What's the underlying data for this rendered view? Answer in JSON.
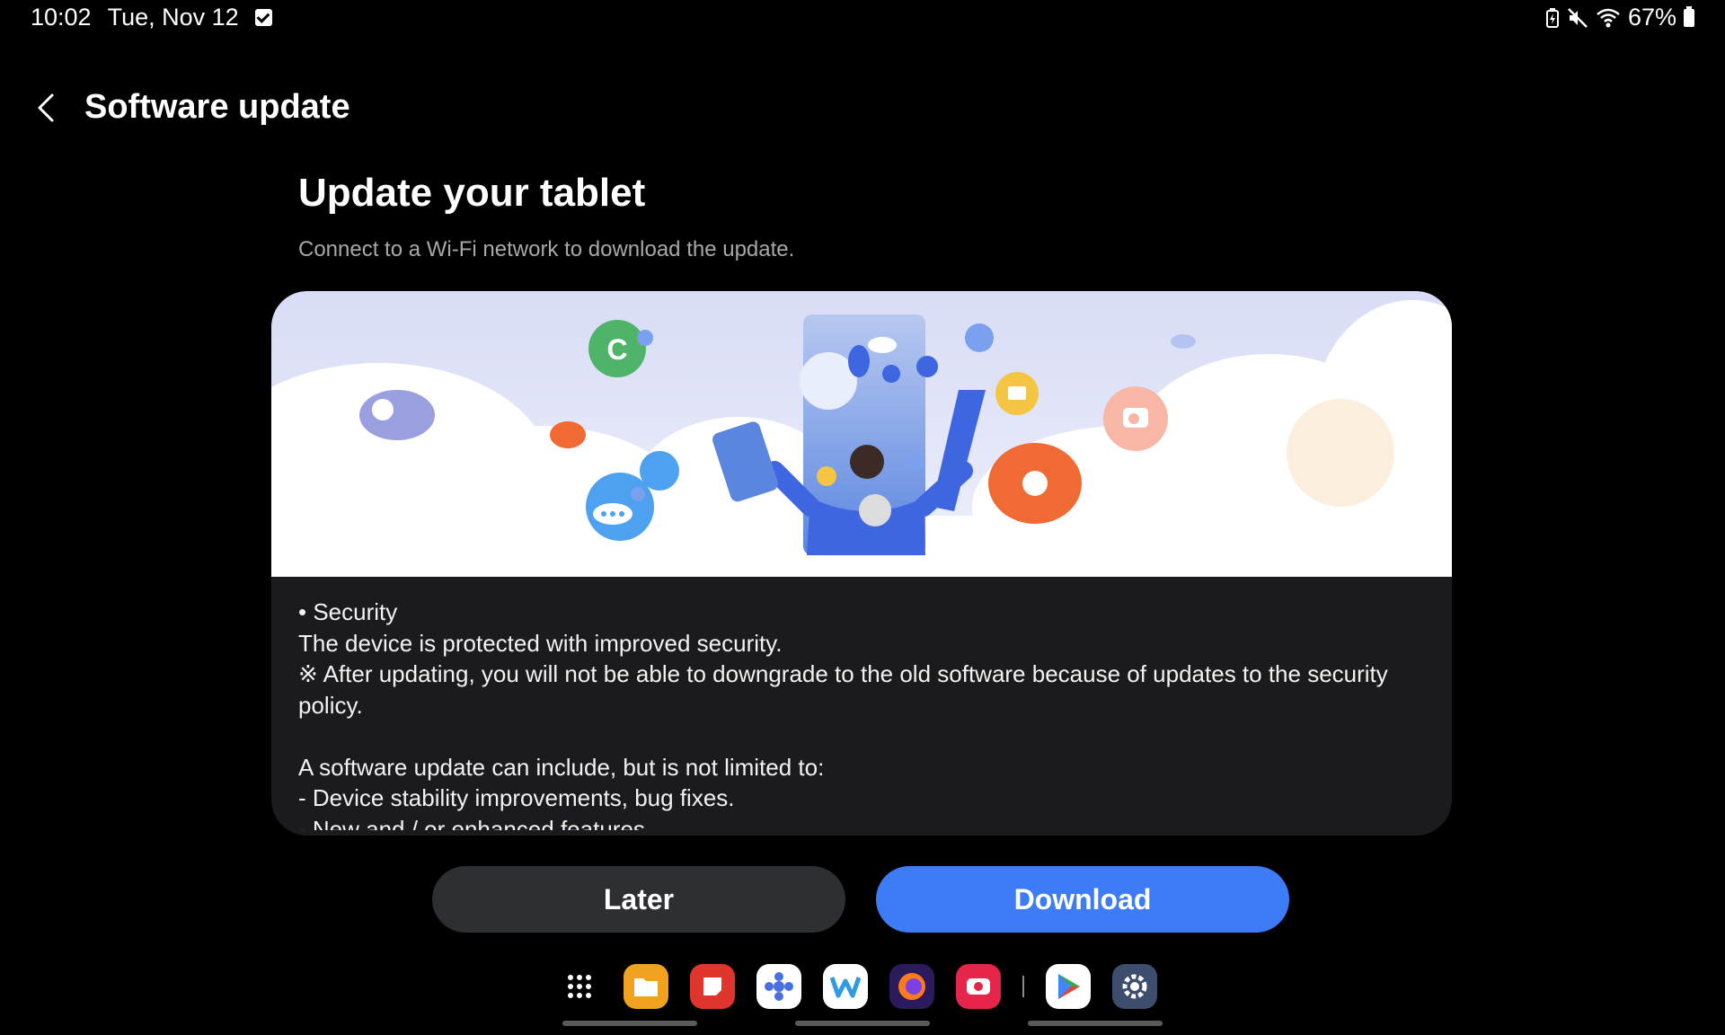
{
  "status": {
    "time": "10:02",
    "date": "Tue, Nov 12",
    "battery": "67%"
  },
  "header": {
    "title": "Software update"
  },
  "main": {
    "headline": "Update your tablet",
    "subtitle": "Connect to a Wi-Fi network to download the update."
  },
  "notes": {
    "line1": "• Security",
    "line2": "The device is protected with improved security.",
    "line3": "※ After updating, you will not be able to downgrade to the old software because of updates to the security policy.",
    "line4": "A software update can include, but is not limited to:",
    "line5": " - Device stability improvements, bug fixes.",
    "line6": " - New and / or enhanced features."
  },
  "buttons": {
    "later": "Later",
    "download": "Download"
  },
  "dock": {
    "apps": [
      "app-drawer",
      "my-files",
      "samsung-notes",
      "bixby",
      "wordle",
      "firefox",
      "screen-recorder",
      "play-store",
      "settings"
    ]
  },
  "colors": {
    "accent": "#3e7cf6",
    "card": "#1b1b1d",
    "button_secondary": "#2e2f32"
  }
}
